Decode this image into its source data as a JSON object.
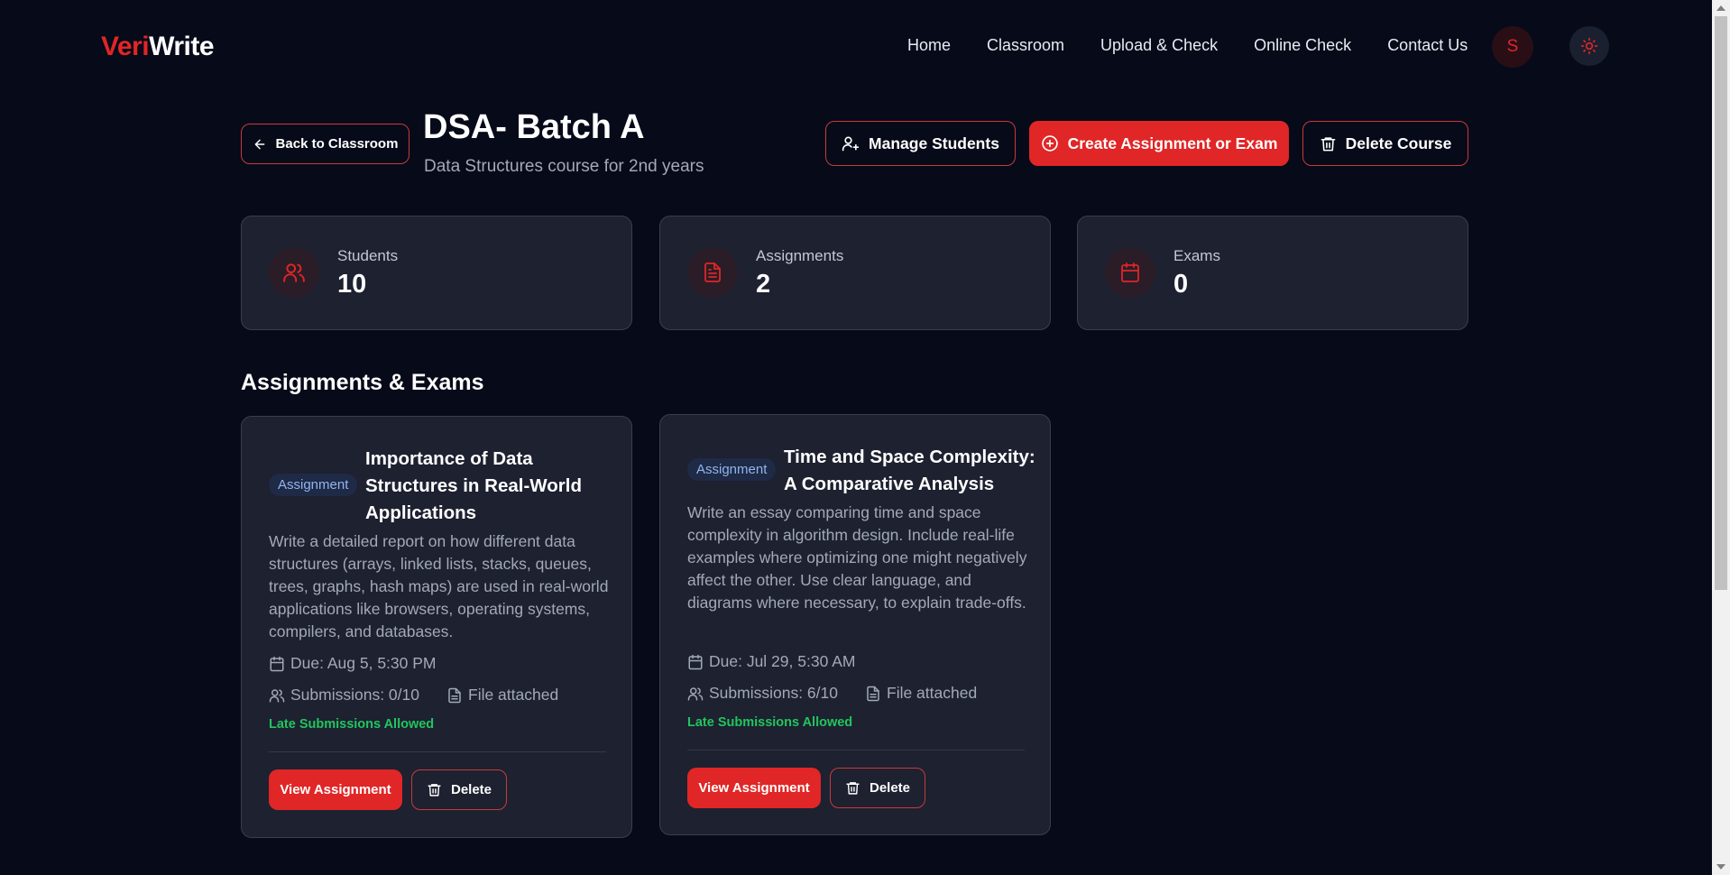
{
  "brand": {
    "part1": "Veri",
    "part2": "Write"
  },
  "nav": {
    "links": [
      "Home",
      "Classroom",
      "Upload & Check",
      "Online Check",
      "Contact Us"
    ],
    "avatar_initial": "S"
  },
  "course": {
    "back_label": "Back to Classroom",
    "title": "DSA- Batch A",
    "subtitle": "Data Structures course for 2nd years",
    "manage_students_label": "Manage Students",
    "create_label": "Create Assignment or Exam",
    "delete_course_label": "Delete Course"
  },
  "stats": [
    {
      "label": "Students",
      "value": "10",
      "icon": "users-icon"
    },
    {
      "label": "Assignments",
      "value": "2",
      "icon": "file-text-icon"
    },
    {
      "label": "Exams",
      "value": "0",
      "icon": "calendar-icon"
    }
  ],
  "section_title": "Assignments & Exams",
  "assignments": [
    {
      "type": "Assignment",
      "title": "Importance of Data Structures in Real-World Applications",
      "description": "Write a detailed report on how different data structures (arrays, linked lists, stacks, queues, trees, graphs, hash maps) are used in real-world applications like browsers, operating systems, compilers, and databases.",
      "due": "Due: Aug 5, 5:30 PM",
      "submissions": "Submissions: 0/10",
      "attachment": "File attached",
      "late_policy": "Late Submissions Allowed",
      "view_label": "View Assignment",
      "delete_label": "Delete"
    },
    {
      "type": "Assignment",
      "title": "Time and Space Complexity: A Comparative Analysis",
      "description": "Write an essay comparing time and space complexity in algorithm design. Include real-life examples where optimizing one might negatively affect the other. Use clear language, and diagrams where necessary, to explain trade-offs.",
      "due": "Due: Jul 29, 5:30 AM",
      "submissions": "Submissions: 6/10",
      "attachment": "File attached",
      "late_policy": "Late Submissions Allowed",
      "view_label": "View Assignment",
      "delete_label": "Delete"
    }
  ],
  "colors": {
    "background": "#060a19",
    "card": "#1d2130",
    "accent": "#e02626",
    "success": "#22c55e",
    "badge_bg": "#1e2a46",
    "badge_text": "#93b4ee"
  }
}
